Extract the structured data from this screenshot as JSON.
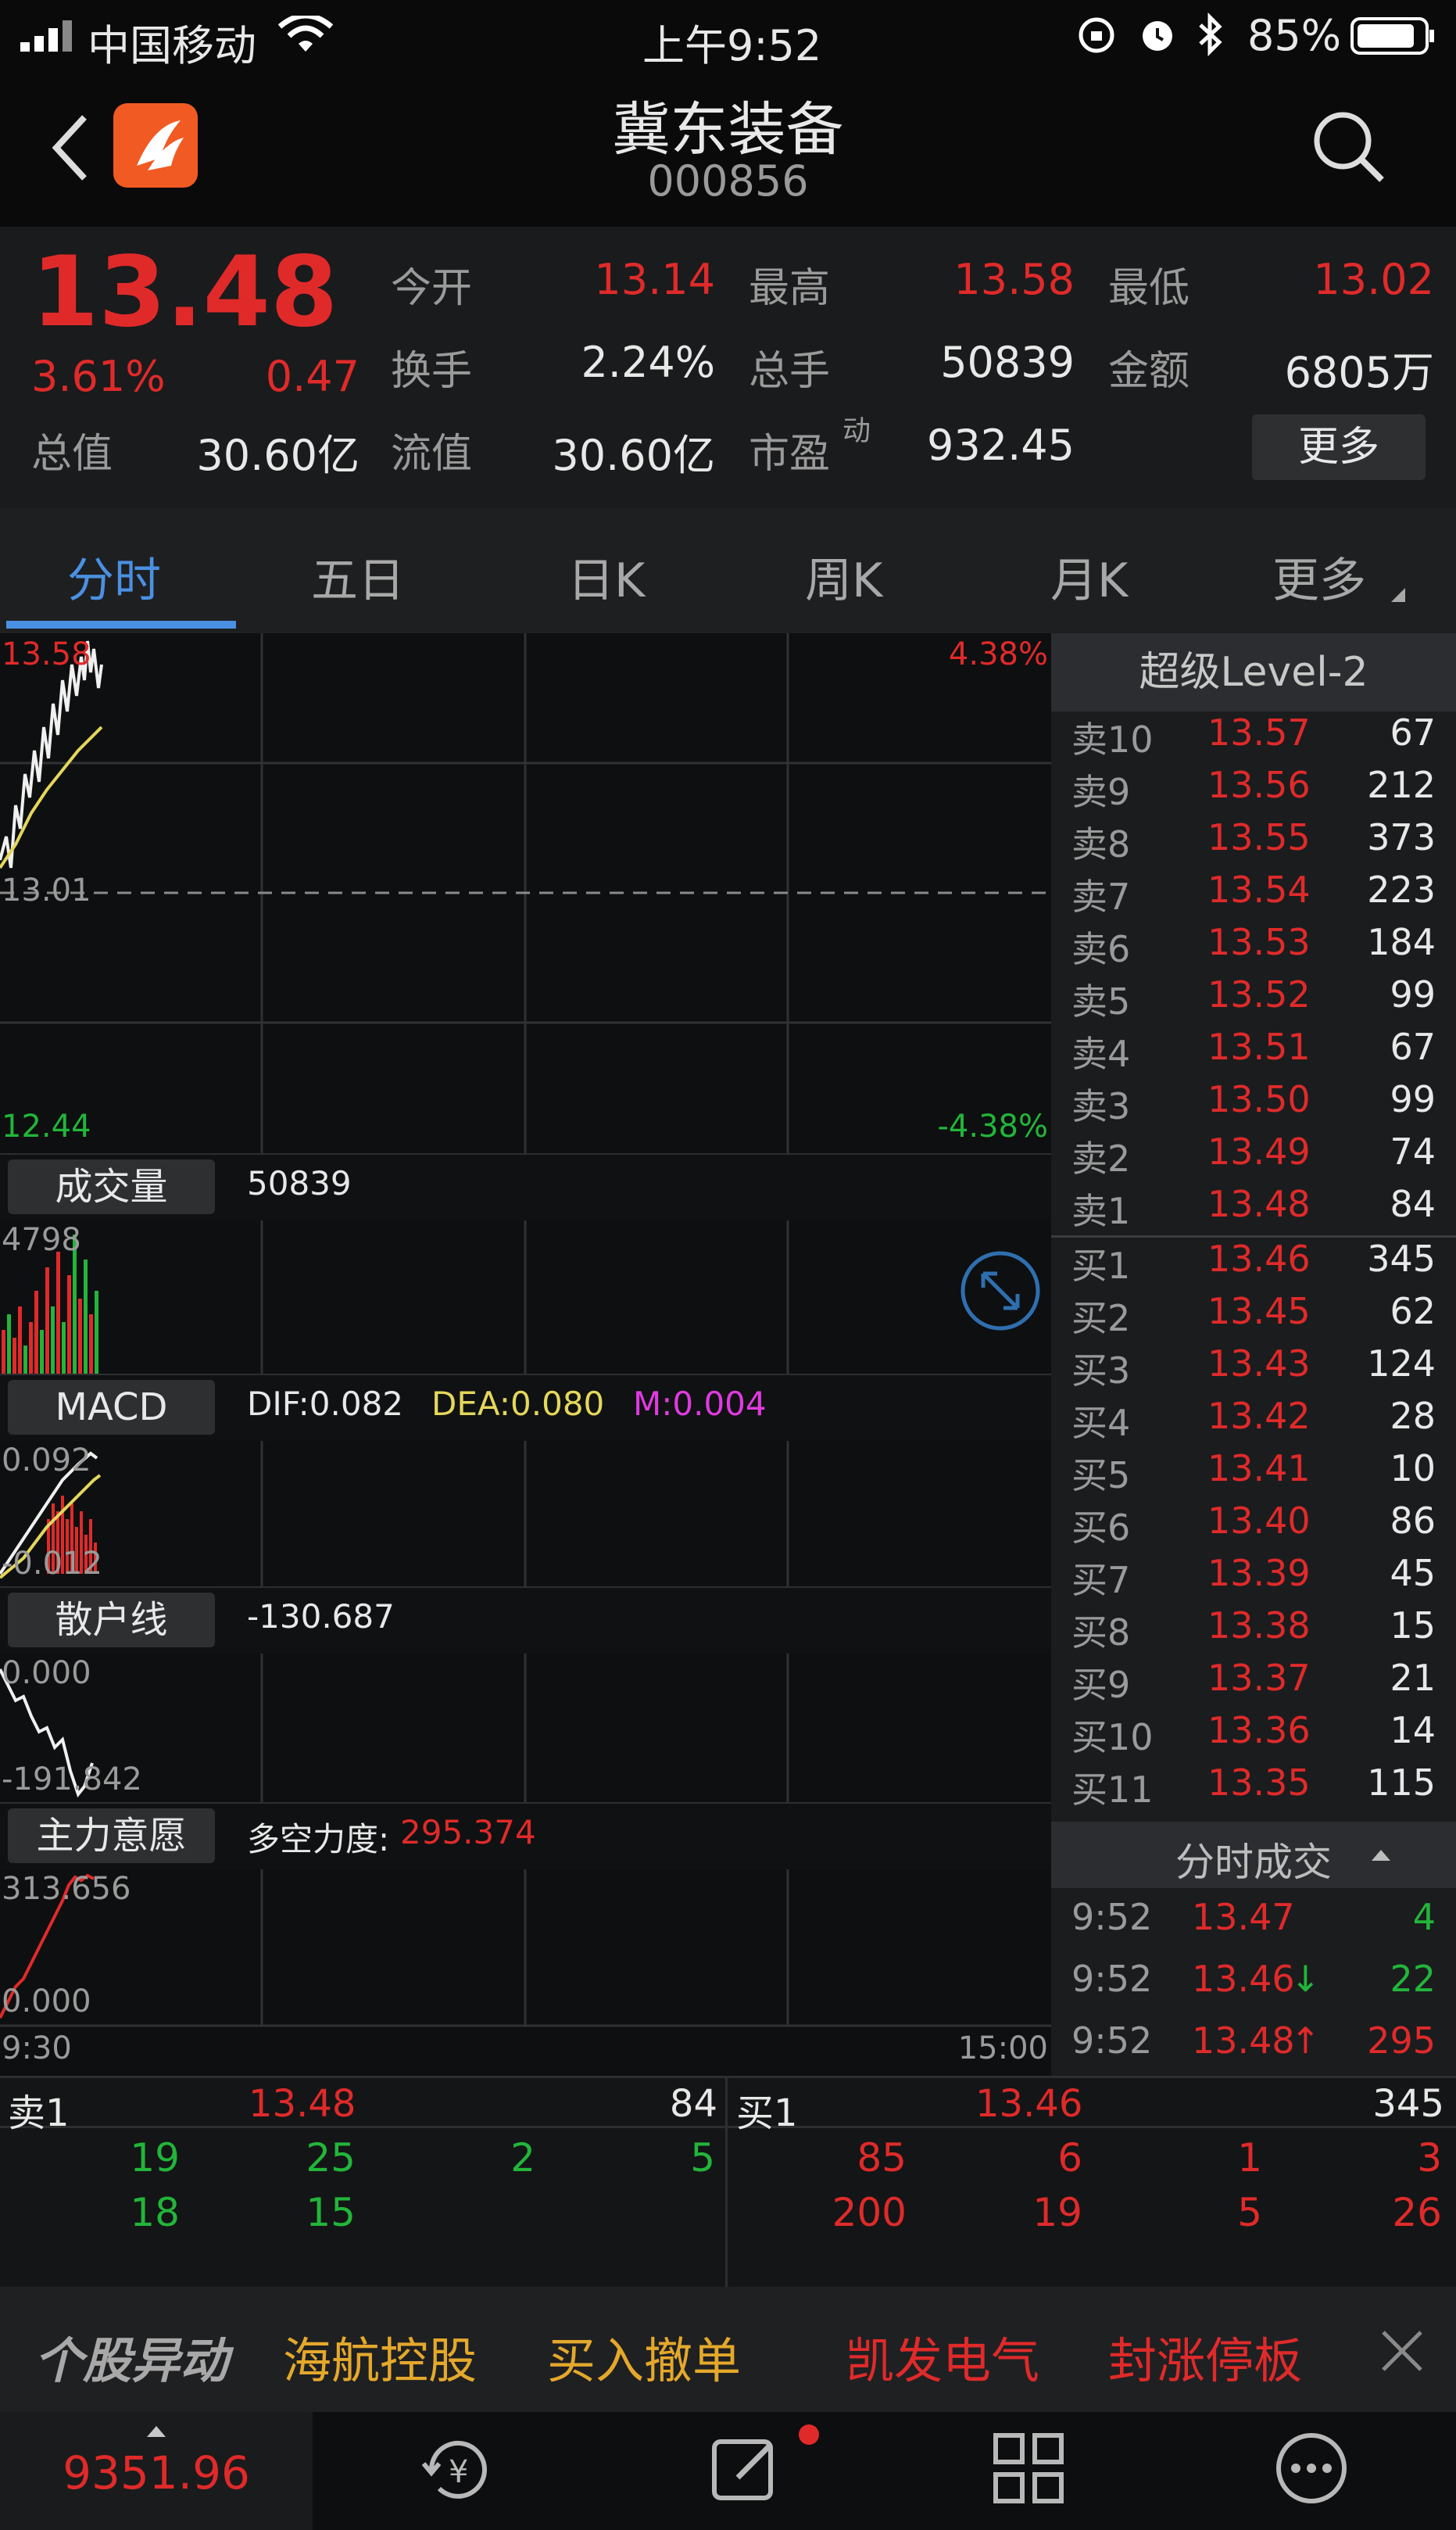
{
  "status_bar": {
    "carrier": "中国移动",
    "time": "上午9:52",
    "battery": "85%",
    "icons": [
      "signal-icon",
      "wifi-icon",
      "orientation-lock-icon",
      "alarm-icon",
      "bluetooth-icon",
      "battery-icon"
    ]
  },
  "header": {
    "title": "冀东装备",
    "code": "000856",
    "back_icon": "chevron-left-icon",
    "app_icon": "app-logo-icon",
    "search_icon": "search-icon"
  },
  "quote": {
    "price": "13.48",
    "change_pct": "3.61%",
    "change": "0.47",
    "total_value_label": "总值",
    "total_value": "30.60亿",
    "rows": [
      [
        {
          "label": "今开",
          "value": "13.14",
          "color": "red"
        },
        {
          "label": "最高",
          "value": "13.58",
          "color": "red"
        },
        {
          "label": "最低",
          "value": "13.02",
          "color": "red"
        }
      ],
      [
        {
          "label": "换手",
          "value": "2.24%",
          "color": "white"
        },
        {
          "label": "总手",
          "value": "50839",
          "color": "white"
        },
        {
          "label": "金额",
          "value": "6805万",
          "color": "white"
        }
      ],
      [
        {
          "label": "流值",
          "value": "30.60亿",
          "color": "white"
        },
        {
          "label": "市盈",
          "value": "932.45",
          "color": "white",
          "sup": "动"
        }
      ]
    ],
    "more_button": "更多"
  },
  "tabs": [
    "分时",
    "五日",
    "日K",
    "周K",
    "月K",
    "更多"
  ],
  "active_tab": 0,
  "intraday": {
    "high_price": "13.58",
    "high_pct": "4.38%",
    "ref_price": "13.01",
    "low_price": "12.44",
    "low_pct": "-4.38%",
    "start_time": "9:30",
    "end_time": "15:00"
  },
  "volume": {
    "label": "成交量",
    "value": "50839",
    "axis_top": "4798"
  },
  "macd": {
    "label": "MACD",
    "dif": "DIF:0.082",
    "dea": "DEA:0.080",
    "m": "M:0.004",
    "axis_top": "0.092",
    "axis_bottom": "-0.012"
  },
  "retail": {
    "label": "散户线",
    "value": "-130.687",
    "axis_top": "0.000",
    "axis_bottom": "-191.842"
  },
  "main_force": {
    "label": "主力意愿",
    "desc": "多空力度:",
    "value": "295.374",
    "axis_top": "313.656",
    "axis_bottom": "0.000"
  },
  "order_book": {
    "title": "超级Level-2",
    "asks": [
      {
        "label": "卖10",
        "price": "13.57",
        "vol": "67"
      },
      {
        "label": "卖9",
        "price": "13.56",
        "vol": "212"
      },
      {
        "label": "卖8",
        "price": "13.55",
        "vol": "373"
      },
      {
        "label": "卖7",
        "price": "13.54",
        "vol": "223"
      },
      {
        "label": "卖6",
        "price": "13.53",
        "vol": "184"
      },
      {
        "label": "卖5",
        "price": "13.52",
        "vol": "99"
      },
      {
        "label": "卖4",
        "price": "13.51",
        "vol": "67"
      },
      {
        "label": "卖3",
        "price": "13.50",
        "vol": "99"
      },
      {
        "label": "卖2",
        "price": "13.49",
        "vol": "74"
      },
      {
        "label": "卖1",
        "price": "13.48",
        "vol": "84"
      }
    ],
    "bids": [
      {
        "label": "买1",
        "price": "13.46",
        "vol": "345"
      },
      {
        "label": "买2",
        "price": "13.45",
        "vol": "62"
      },
      {
        "label": "买3",
        "price": "13.43",
        "vol": "124"
      },
      {
        "label": "买4",
        "price": "13.42",
        "vol": "28"
      },
      {
        "label": "买5",
        "price": "13.41",
        "vol": "10"
      },
      {
        "label": "买6",
        "price": "13.40",
        "vol": "86"
      },
      {
        "label": "买7",
        "price": "13.39",
        "vol": "45"
      },
      {
        "label": "买8",
        "price": "13.38",
        "vol": "15"
      },
      {
        "label": "买9",
        "price": "13.37",
        "vol": "21"
      },
      {
        "label": "买10",
        "price": "13.36",
        "vol": "14"
      },
      {
        "label": "买11",
        "price": "13.35",
        "vol": "115"
      }
    ],
    "ticks_title": "分时成交",
    "ticks": [
      {
        "time": "9:52",
        "price": "13.47",
        "arrow": "",
        "vol": "4",
        "color": "green"
      },
      {
        "time": "9:52",
        "price": "13.46",
        "arrow": "↓",
        "vol": "22",
        "color": "green"
      },
      {
        "time": "9:52",
        "price": "13.48",
        "arrow": "↑",
        "vol": "295",
        "color": "red"
      }
    ]
  },
  "queue": {
    "sell_label": "卖1",
    "sell_price": "13.48",
    "sell_vol": "84",
    "buy_label": "买1",
    "buy_price": "13.46",
    "buy_vol": "345",
    "sell_rows": [
      [
        "19",
        "25",
        "2",
        "5"
      ],
      [
        "18",
        "15"
      ]
    ],
    "buy_rows": [
      [
        "85",
        "6",
        "1",
        "3"
      ],
      [
        "200",
        "19",
        "5",
        "26"
      ]
    ]
  },
  "ticker": {
    "title": "个股异动",
    "items": [
      "海航控股",
      "买入撤单",
      "凯发电气",
      "封涨停板"
    ],
    "close_icon": "close-icon"
  },
  "bottom_nav": {
    "index_value": "9351.96"
  }
}
